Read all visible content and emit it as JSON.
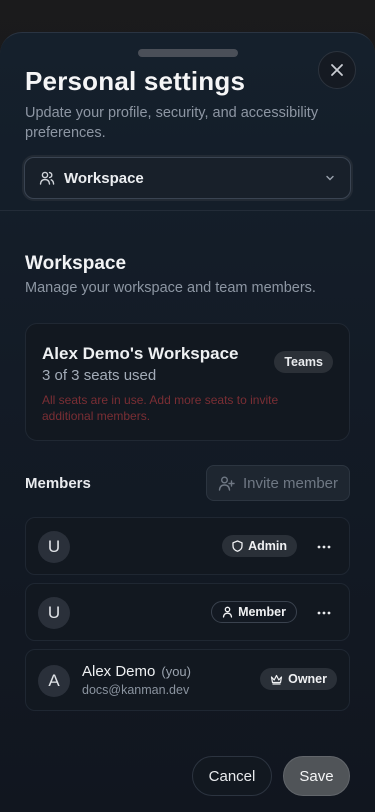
{
  "header": {
    "title": "Personal settings",
    "subtitle": "Update your profile, security, and accessibility preferences.",
    "close_icon": "close-icon"
  },
  "section_select": {
    "selected": "Workspace",
    "icon": "users-icon"
  },
  "workspace": {
    "title": "Workspace",
    "description": "Manage your workspace and team members.",
    "card": {
      "name": "Alex Demo's Workspace",
      "seats": "3 of 3 seats used",
      "warning": "All seats are in use. Add more seats to invite additional members.",
      "plan_badge": "Teams"
    }
  },
  "members": {
    "label": "Members",
    "invite_label": "Invite member",
    "rows": [
      {
        "avatar": "U",
        "name": "",
        "you": "",
        "email": "",
        "role": "Admin",
        "role_icon": "shield-icon"
      },
      {
        "avatar": "U",
        "name": "",
        "you": "",
        "email": "",
        "role": "Member",
        "role_icon": "user-icon"
      },
      {
        "avatar": "A",
        "name": "Alex Demo",
        "you": "(you)",
        "email": "docs@kanman.dev",
        "role": "Owner",
        "role_icon": "crown-icon"
      }
    ]
  },
  "footer": {
    "cancel_label": "Cancel",
    "save_label": "Save"
  },
  "colors": {
    "warning_text": "#7a2e34",
    "sheet_bg": "#131b26"
  }
}
